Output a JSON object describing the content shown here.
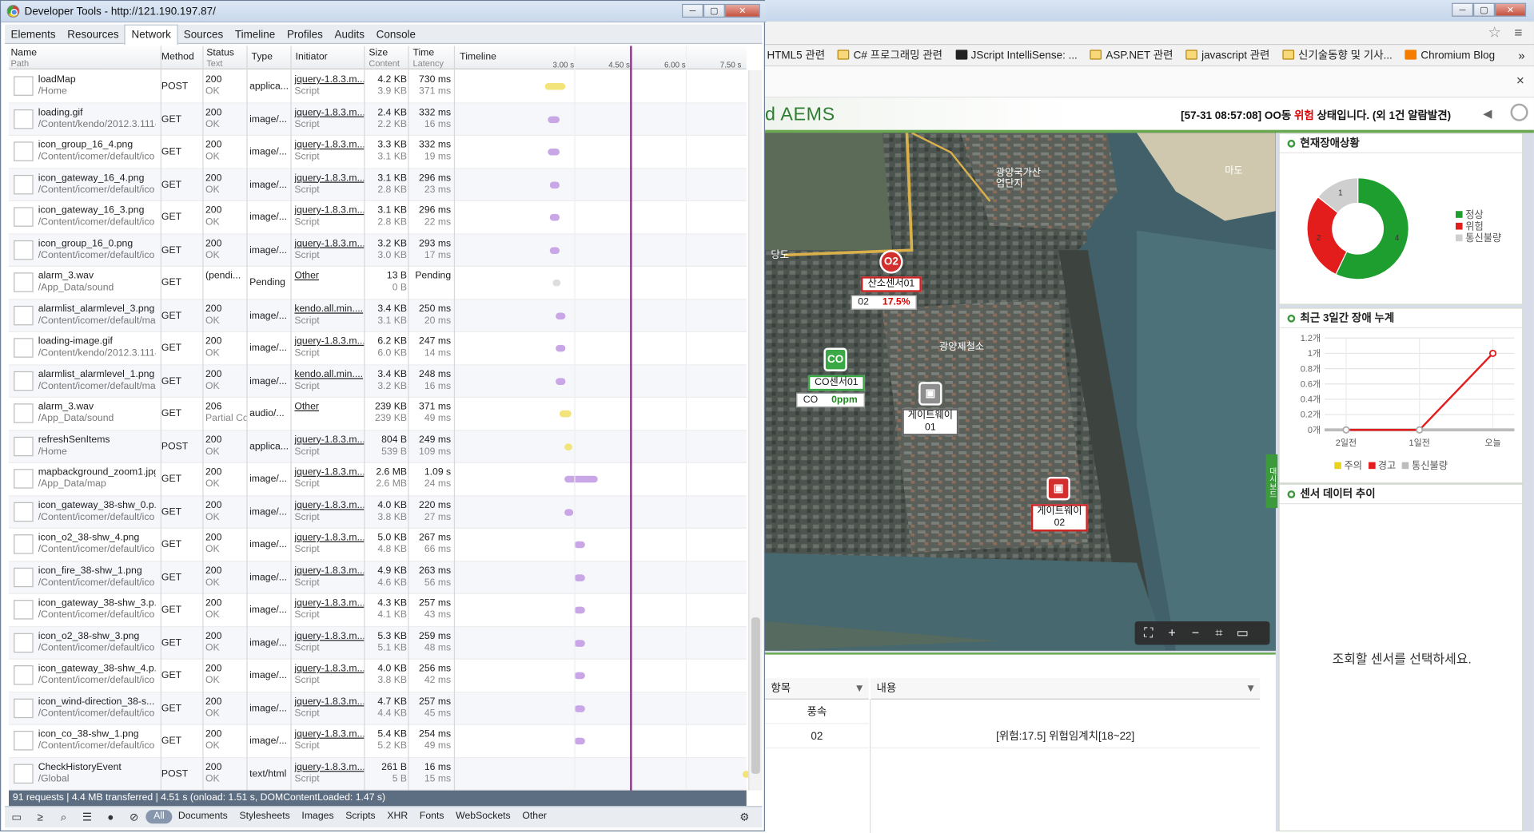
{
  "devtools": {
    "title": "Developer Tools - http://121.190.197.87/",
    "tabs": [
      "Elements",
      "Resources",
      "Network",
      "Sources",
      "Timeline",
      "Profiles",
      "Audits",
      "Console"
    ],
    "selected_tab": "Network",
    "columns": {
      "name": "Name",
      "path": "Path",
      "method": "Method",
      "status": "Status",
      "status_sub": "Text",
      "type": "Type",
      "initiator": "Initiator",
      "size": "Size",
      "size_sub": "Content",
      "time": "Time",
      "time_sub": "Latency",
      "timeline": "Timeline"
    },
    "ticks": [
      "3.00 s",
      "4.50 s",
      "6.00 s",
      "7.50 s"
    ],
    "requests": [
      {
        "name": "loadMap",
        "path": "/Home",
        "method": "POST",
        "status": "200",
        "text": "OK",
        "type": "applica...",
        "initiator": "jquery-1.8.3.m...",
        "init_sub": "Script",
        "size": "4.2 KB",
        "content": "3.9 KB",
        "time": "730 ms",
        "latency": "371 ms",
        "bar": [
          0.31,
          0.38
        ],
        "color": "#f2e37a"
      },
      {
        "name": "loading.gif",
        "path": "/Content/kendo/2012.3.1114",
        "method": "GET",
        "status": "200",
        "text": "OK",
        "type": "image/...",
        "initiator": "jquery-1.8.3.m...",
        "init_sub": "Script",
        "size": "2.4 KB",
        "content": "2.2 KB",
        "time": "332 ms",
        "latency": "16 ms",
        "bar": [
          0.32,
          0.36
        ],
        "color": "#c9a6e6"
      },
      {
        "name": "icon_group_16_4.png",
        "path": "/Content/icomer/default/ico",
        "method": "GET",
        "status": "200",
        "text": "OK",
        "type": "image/...",
        "initiator": "jquery-1.8.3.m...",
        "init_sub": "Script",
        "size": "3.3 KB",
        "content": "3.1 KB",
        "time": "332 ms",
        "latency": "19 ms",
        "bar": [
          0.32,
          0.36
        ],
        "color": "#c9a6e6"
      },
      {
        "name": "icon_gateway_16_4.png",
        "path": "/Content/icomer/default/ico",
        "method": "GET",
        "status": "200",
        "text": "OK",
        "type": "image/...",
        "initiator": "jquery-1.8.3.m...",
        "init_sub": "Script",
        "size": "3.1 KB",
        "content": "2.8 KB",
        "time": "296 ms",
        "latency": "23 ms",
        "bar": [
          0.325,
          0.36
        ],
        "color": "#c9a6e6"
      },
      {
        "name": "icon_gateway_16_3.png",
        "path": "/Content/icomer/default/ico",
        "method": "GET",
        "status": "200",
        "text": "OK",
        "type": "image/...",
        "initiator": "jquery-1.8.3.m...",
        "init_sub": "Script",
        "size": "3.1 KB",
        "content": "2.8 KB",
        "time": "296 ms",
        "latency": "22 ms",
        "bar": [
          0.325,
          0.36
        ],
        "color": "#c9a6e6"
      },
      {
        "name": "icon_group_16_0.png",
        "path": "/Content/icomer/default/ico",
        "method": "GET",
        "status": "200",
        "text": "OK",
        "type": "image/...",
        "initiator": "jquery-1.8.3.m...",
        "init_sub": "Script",
        "size": "3.2 KB",
        "content": "3.0 KB",
        "time": "293 ms",
        "latency": "17 ms",
        "bar": [
          0.325,
          0.36
        ],
        "color": "#c9a6e6"
      },
      {
        "name": "alarm_3.wav",
        "path": "/App_Data/sound",
        "method": "GET",
        "status": "(pendi...",
        "text": "",
        "type": "Pending",
        "initiator": "Other",
        "init_sub": "",
        "size": "13 B",
        "content": "0 B",
        "time": "Pending",
        "latency": "",
        "bar": [
          0.335,
          0.345
        ],
        "color": "#dddddd"
      },
      {
        "name": "alarmlist_alarmlevel_3.png",
        "path": "/Content/icomer/default/ma",
        "method": "GET",
        "status": "200",
        "text": "OK",
        "type": "image/...",
        "initiator": "kendo.all.min....",
        "init_sub": "Script",
        "size": "3.4 KB",
        "content": "3.1 KB",
        "time": "250 ms",
        "latency": "20 ms",
        "bar": [
          0.345,
          0.38
        ],
        "color": "#c9a6e6"
      },
      {
        "name": "loading-image.gif",
        "path": "/Content/kendo/2012.3.1114",
        "method": "GET",
        "status": "200",
        "text": "OK",
        "type": "image/...",
        "initiator": "jquery-1.8.3.m...",
        "init_sub": "Script",
        "size": "6.2 KB",
        "content": "6.0 KB",
        "time": "247 ms",
        "latency": "14 ms",
        "bar": [
          0.345,
          0.38
        ],
        "color": "#c9a6e6"
      },
      {
        "name": "alarmlist_alarmlevel_1.png",
        "path": "/Content/icomer/default/ma",
        "method": "GET",
        "status": "200",
        "text": "OK",
        "type": "image/...",
        "initiator": "kendo.all.min....",
        "init_sub": "Script",
        "size": "3.4 KB",
        "content": "3.2 KB",
        "time": "248 ms",
        "latency": "16 ms",
        "bar": [
          0.345,
          0.38
        ],
        "color": "#c9a6e6"
      },
      {
        "name": "alarm_3.wav",
        "path": "/App_Data/sound",
        "method": "GET",
        "status": "206",
        "text": "Partial Cc",
        "type": "audio/...",
        "initiator": "Other",
        "init_sub": "",
        "size": "239 KB",
        "content": "239 KB",
        "time": "371 ms",
        "latency": "49 ms",
        "bar": [
          0.36,
          0.4
        ],
        "color": "#f2e37a"
      },
      {
        "name": "refreshSenItems",
        "path": "/Home",
        "method": "POST",
        "status": "200",
        "text": "OK",
        "type": "applica...",
        "initiator": "jquery-1.8.3.m...",
        "init_sub": "Script",
        "size": "804 B",
        "content": "539 B",
        "time": "249 ms",
        "latency": "109 ms",
        "bar": [
          0.375,
          0.395
        ],
        "color": "#f2e37a"
      },
      {
        "name": "mapbackground_zoom1.jpg",
        "path": "/App_Data/map",
        "method": "GET",
        "status": "200",
        "text": "OK",
        "type": "image/...",
        "initiator": "jquery-1.8.3.m...",
        "init_sub": "Script",
        "size": "2.6 MB",
        "content": "2.6 MB",
        "time": "1.09 s",
        "latency": "24 ms",
        "bar": [
          0.375,
          0.49
        ],
        "color": "#c9a6e6"
      },
      {
        "name": "icon_gateway_38-shw_0.p...",
        "path": "/Content/icomer/default/ico",
        "method": "GET",
        "status": "200",
        "text": "OK",
        "type": "image/...",
        "initiator": "jquery-1.8.3.m...",
        "init_sub": "Script",
        "size": "4.0 KB",
        "content": "3.8 KB",
        "time": "220 ms",
        "latency": "27 ms",
        "bar": [
          0.375,
          0.405
        ],
        "color": "#c9a6e6"
      },
      {
        "name": "icon_o2_38-shw_4.png",
        "path": "/Content/icomer/default/ico",
        "method": "GET",
        "status": "200",
        "text": "OK",
        "type": "image/...",
        "initiator": "jquery-1.8.3.m...",
        "init_sub": "Script",
        "size": "5.0 KB",
        "content": "4.8 KB",
        "time": "267 ms",
        "latency": "66 ms",
        "bar": [
          0.41,
          0.445
        ],
        "color": "#c9a6e6"
      },
      {
        "name": "icon_fire_38-shw_1.png",
        "path": "/Content/icomer/default/ico",
        "method": "GET",
        "status": "200",
        "text": "OK",
        "type": "image/...",
        "initiator": "jquery-1.8.3.m...",
        "init_sub": "Script",
        "size": "4.9 KB",
        "content": "4.6 KB",
        "time": "263 ms",
        "latency": "56 ms",
        "bar": [
          0.41,
          0.445
        ],
        "color": "#c9a6e6"
      },
      {
        "name": "icon_gateway_38-shw_3.p...",
        "path": "/Content/icomer/default/ico",
        "method": "GET",
        "status": "200",
        "text": "OK",
        "type": "image/...",
        "initiator": "jquery-1.8.3.m...",
        "init_sub": "Script",
        "size": "4.3 KB",
        "content": "4.1 KB",
        "time": "257 ms",
        "latency": "43 ms",
        "bar": [
          0.41,
          0.445
        ],
        "color": "#c9a6e6"
      },
      {
        "name": "icon_o2_38-shw_3.png",
        "path": "/Content/icomer/default/ico",
        "method": "GET",
        "status": "200",
        "text": "OK",
        "type": "image/...",
        "initiator": "jquery-1.8.3.m...",
        "init_sub": "Script",
        "size": "5.3 KB",
        "content": "5.1 KB",
        "time": "259 ms",
        "latency": "48 ms",
        "bar": [
          0.41,
          0.445
        ],
        "color": "#c9a6e6"
      },
      {
        "name": "icon_gateway_38-shw_4.p...",
        "path": "/Content/icomer/default/ico",
        "method": "GET",
        "status": "200",
        "text": "OK",
        "type": "image/...",
        "initiator": "jquery-1.8.3.m...",
        "init_sub": "Script",
        "size": "4.0 KB",
        "content": "3.8 KB",
        "time": "256 ms",
        "latency": "42 ms",
        "bar": [
          0.41,
          0.445
        ],
        "color": "#c9a6e6"
      },
      {
        "name": "icon_wind-direction_38-s...",
        "path": "/Content/icomer/default/ico",
        "method": "GET",
        "status": "200",
        "text": "OK",
        "type": "image/...",
        "initiator": "jquery-1.8.3.m...",
        "init_sub": "Script",
        "size": "4.7 KB",
        "content": "4.4 KB",
        "time": "257 ms",
        "latency": "45 ms",
        "bar": [
          0.41,
          0.445
        ],
        "color": "#c9a6e6"
      },
      {
        "name": "icon_co_38-shw_1.png",
        "path": "/Content/icomer/default/ico",
        "method": "GET",
        "status": "200",
        "text": "OK",
        "type": "image/...",
        "initiator": "jquery-1.8.3.m...",
        "init_sub": "Script",
        "size": "5.4 KB",
        "content": "5.2 KB",
        "time": "254 ms",
        "latency": "49 ms",
        "bar": [
          0.41,
          0.445
        ],
        "color": "#c9a6e6"
      },
      {
        "name": "CheckHistoryEvent",
        "path": "/Global",
        "method": "POST",
        "status": "200",
        "text": "OK",
        "type": "text/html",
        "initiator": "jquery-1.8.3.m...",
        "init_sub": "Script",
        "size": "261 B",
        "content": "5 B",
        "time": "16 ms",
        "latency": "15 ms",
        "bar": [
          0.985,
          0.995
        ],
        "color": "#f2e37a"
      }
    ],
    "status_bar": "91 requests  |  4.4 MB transferred  |  4.51 s (onload: 1.51 s, DOMContentLoaded: 1.47 s)",
    "filters": [
      "All",
      "Documents",
      "Stylesheets",
      "Images",
      "Scripts",
      "XHR",
      "Fonts",
      "WebSockets",
      "Other"
    ],
    "selected_filter": "All"
  },
  "browser": {
    "bookmarks": [
      "HTML5 관련",
      "C# 프로그래밍 관련",
      "JScript IntelliSense: ...",
      "ASP.NET 관련",
      "javascript 관련",
      "신기술동향 및 기사...",
      "Chromium Blog"
    ],
    "bookmark_more": "»",
    "close_x": "×"
  },
  "app": {
    "logo": "d AEMS",
    "alarm_pre": "[57-31 08:57:08] OO동 ",
    "alarm_red": "위험",
    "alarm_post": " 상태입니다. (외 1건 알람발견)",
    "map": {
      "labels": [
        "광양국가산업단지",
        "마도",
        "광양제철소",
        "당도"
      ],
      "markers": [
        {
          "icon": "O2",
          "name": "산소센서01",
          "val_label": "02",
          "val": "17.5%",
          "color": "#d32f2f"
        },
        {
          "icon": "CO",
          "name": "CO센서01",
          "val_label": "CO",
          "val": "0ppm",
          "color": "#3aa845"
        },
        {
          "icon": "▣",
          "name": "게이트웨이\n01",
          "color": "#8e8e8e"
        },
        {
          "icon": "▣",
          "name": "게이트웨이\n02",
          "color": "#d32f2f"
        }
      ],
      "controls": [
        "⛶",
        "+",
        "−",
        "⌗",
        "▭"
      ]
    },
    "panels": {
      "status_title": "현재장애상황",
      "pie": {
        "type": "pie",
        "title": "현재장애상황",
        "slices": [
          {
            "name": "정상",
            "value": 4,
            "color": "#1e9e2e"
          },
          {
            "name": "위험",
            "value": 2,
            "color": "#e31c1c"
          },
          {
            "name": "통신불량",
            "value": 1,
            "color": "#cfcfcf"
          }
        ],
        "labels_shown": [
          "1",
          "2",
          "4"
        ]
      },
      "line_title": "최근 3일간 장애 누계",
      "line": {
        "type": "line",
        "x": [
          "2일전",
          "1일전",
          "오늘"
        ],
        "series": [
          {
            "name": "경고",
            "values": [
              0,
              0,
              1
            ],
            "color": "#e31c1c"
          }
        ],
        "yticks": [
          "1.2개",
          "1개",
          "0.8개",
          "0.6개",
          "0.4개",
          "0.2개",
          "0개"
        ],
        "ylim": [
          0,
          1.2
        ],
        "legend": [
          {
            "name": "주의",
            "color": "#e8d21c"
          },
          {
            "name": "경고",
            "color": "#e31c1c"
          },
          {
            "name": "통신불량",
            "color": "#bdbdbd"
          }
        ]
      },
      "trend_title": "센서 데이터 추이",
      "trend_empty": "조회할 센서를 선택하세요.",
      "side_tab": "대시보드"
    },
    "table": {
      "col1": "항목",
      "col2": "내용",
      "rows": [
        [
          "풍속",
          ""
        ],
        [
          "02",
          "[위험:17.5] 위험임계치[18~22]"
        ]
      ]
    }
  }
}
